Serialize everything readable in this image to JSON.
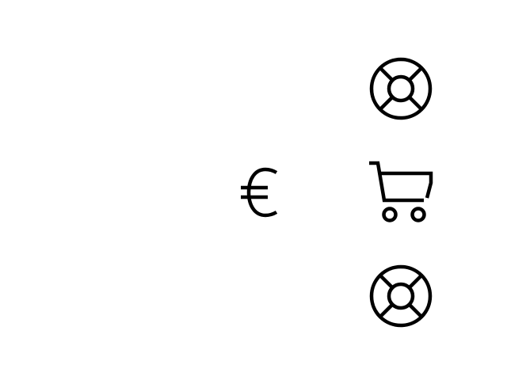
{
  "icons": {
    "top_right": "lifebuoy-icon",
    "middle_center": "euro-icon",
    "middle_right": "shopping-cart-icon",
    "bottom_right": "lifebuoy-icon"
  },
  "colors": {
    "background": "#ffffff",
    "icon_stroke": "#000000"
  }
}
